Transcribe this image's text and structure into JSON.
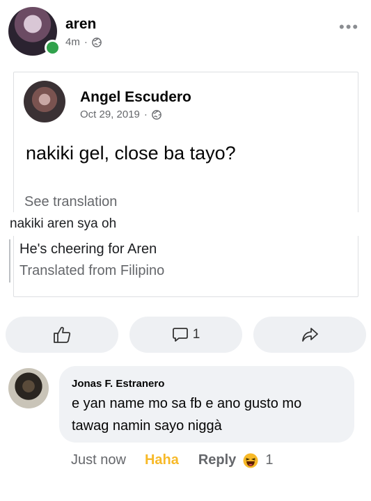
{
  "post": {
    "author": "aren",
    "time": "4m",
    "separator": "·",
    "more_label": "•••"
  },
  "shared_post": {
    "author": "Angel Escudero",
    "date": "Oct 29, 2019",
    "separator": "·",
    "text": "nakiki gel, close ba tayo?",
    "see_translation": "See translation"
  },
  "caption": {
    "text": "nakiki aren sya oh",
    "translation": "He's cheering for Aren",
    "translated_from": "Translated from Filipino"
  },
  "actions": {
    "comment_count": "1"
  },
  "comment": {
    "author": "Jonas F. Estranero",
    "line1": "e yan name mo sa fb e ano gusto mo",
    "line2": "tawag namin sayo niggà",
    "time": "Just now",
    "reaction_label": "Haha",
    "reply_label": "Reply",
    "reaction_count": "1"
  },
  "colors": {
    "accent_haha": "#f7b928",
    "online": "#31a24c",
    "secondary_text": "#65676b"
  }
}
